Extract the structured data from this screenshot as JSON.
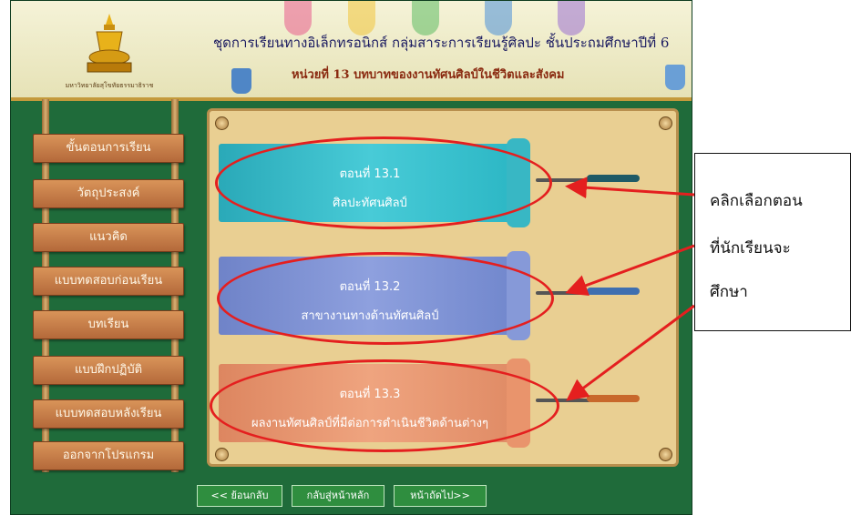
{
  "header": {
    "logo_text": "มหาวิทยาลัยสุโขทัยธรรมาธิราช",
    "course_title": "ชุดการเรียนทางอิเล็กทรอนิกส์ กลุ่มสาระการเรียนรู้ศิลปะ ชั้นประถมศึกษาปีที่ 6",
    "unit_title": "หน่วยที่ 13 บทบาทของงานทัศนศิลป์ในชีวิตและสังคม"
  },
  "sidebar": {
    "items": [
      {
        "label": "ขั้นตอนการเรียน"
      },
      {
        "label": "วัตถุประสงค์"
      },
      {
        "label": "แนวคิด"
      },
      {
        "label": "แบบทดสอบก่อนเรียน"
      },
      {
        "label": "บทเรียน"
      },
      {
        "label": "แบบฝึกปฏิบัติ"
      },
      {
        "label": "แบบทดสอบหลังเรียน"
      },
      {
        "label": "ออกจากโปรแกรม"
      }
    ]
  },
  "lessons": [
    {
      "heading": "ตอนที่ 13.1",
      "title": "ศิลปะทัศนศิลป์",
      "color": "#35c2cf"
    },
    {
      "heading": "ตอนที่ 13.2",
      "title": "สาขางานทางด้านทัศนศิลป์",
      "color": "#7f93d6"
    },
    {
      "heading": "ตอนที่ 13.3",
      "title": "ผลงานทัศนศิลป์ที่มีต่อการดำเนินชีวิตด้านต่างๆ",
      "color": "#e7956e"
    }
  ],
  "footer": {
    "back_label": "<< ย้อนกลับ",
    "home_label": "กลับสู่หน้าหลัก",
    "next_label": "หน้าถัดไป>>"
  },
  "annotation": {
    "lines": [
      "คลิกเลือกตอน",
      "ที่นักเรียนจะ",
      "ศึกษา"
    ],
    "highlight_color": "#e41f1f"
  }
}
